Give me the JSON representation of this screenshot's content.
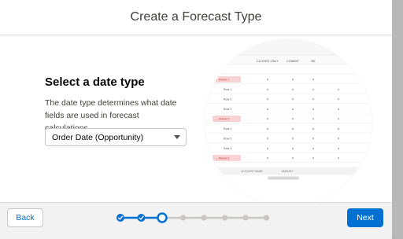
{
  "modal": {
    "title": "Create a Forecast Type"
  },
  "step": {
    "heading": "Select a date type",
    "description": "The date type determines what date fields are used in forecast calculations."
  },
  "date_type_select": {
    "selected": "Order Date (Opportunity)"
  },
  "preview_table": {
    "headers": [
      "CLOSED ONLY",
      "COMMIT",
      "BE"
    ],
    "first_col_header": "ES",
    "rows": [
      {
        "label": "Period 1",
        "group": true
      },
      {
        "label": "Row 1",
        "group": false
      },
      {
        "label": "Row 2",
        "group": false
      },
      {
        "label": "Row 3",
        "group": false
      },
      {
        "label": "Period 2",
        "group": true
      },
      {
        "label": "Row 1",
        "group": false
      },
      {
        "label": "Row 2",
        "group": false
      },
      {
        "label": "Row 3",
        "group": false
      },
      {
        "label": "Period 3",
        "group": true
      }
    ],
    "footer_labels": [
      "ACCOUNT NAME",
      "AMOUNT"
    ]
  },
  "progress": {
    "total_steps": 8,
    "current_step": 3,
    "completed_steps": 2
  },
  "footer": {
    "back_label": "Back",
    "next_label": "Next"
  },
  "colors": {
    "brand": "#0070d2",
    "progress_inactive": "#c9c7c5",
    "period_highlight": "#f9d3d3"
  }
}
